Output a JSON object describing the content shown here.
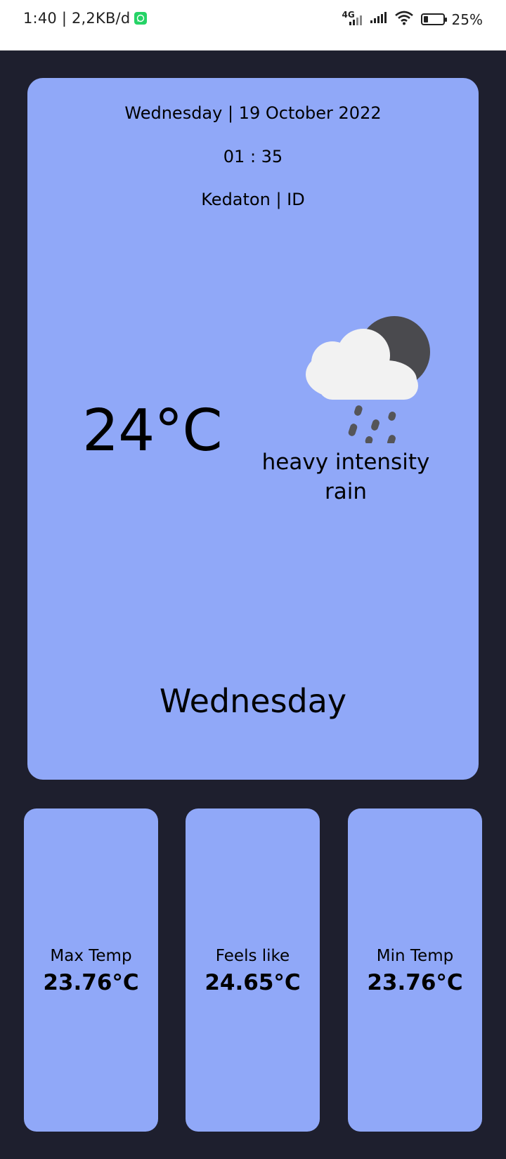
{
  "status_bar": {
    "time_speed": "1:40 | 2,2KB/d",
    "network": "4G",
    "battery": "25%",
    "battery_level": 0.25
  },
  "weather": {
    "date": "Wednesday | 19 October 2022",
    "time": "01 : 35",
    "location": "Kedaton | ID",
    "temperature": "24°C",
    "condition_line1": "heavy intensity",
    "condition_line2": "rain",
    "day": "Wednesday",
    "icon": "cloud-rain-moon-icon"
  },
  "stats": [
    {
      "label": "Max Temp",
      "value": "23.76°C"
    },
    {
      "label": "Feels like",
      "value": "24.65°C"
    },
    {
      "label": "Min Temp",
      "value": "23.76°C"
    }
  ],
  "colors": {
    "background": "#1e1f2e",
    "card": "#90a8f8",
    "status_bar": "#ffffff"
  }
}
